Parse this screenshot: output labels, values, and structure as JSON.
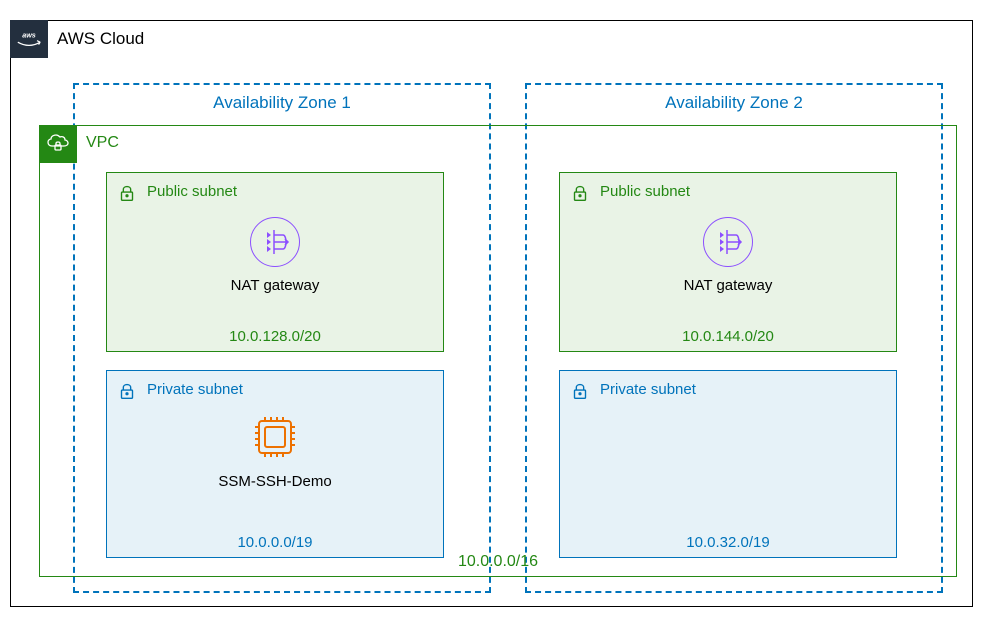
{
  "cloud": {
    "title": "AWS Cloud"
  },
  "vpc": {
    "title": "VPC",
    "cidr": "10.0.0.0/16"
  },
  "availability_zones": [
    {
      "title": "Availability Zone 1",
      "public_subnet": {
        "title": "Public subnet",
        "cidr": "10.0.128.0/20",
        "resource": {
          "type": "nat-gateway",
          "label": "NAT gateway"
        }
      },
      "private_subnet": {
        "title": "Private subnet",
        "cidr": "10.0.0.0/19",
        "resource": {
          "type": "ec2-instance",
          "label": "SSM-SSH-Demo"
        }
      }
    },
    {
      "title": "Availability Zone 2",
      "public_subnet": {
        "title": "Public subnet",
        "cidr": "10.0.144.0/20",
        "resource": {
          "type": "nat-gateway",
          "label": "NAT gateway"
        }
      },
      "private_subnet": {
        "title": "Private subnet",
        "cidr": "10.0.32.0/19",
        "resource": null
      }
    }
  ],
  "colors": {
    "aws_dark": "#232F3E",
    "green": "#248814",
    "blue": "#0073BB",
    "purple": "#8C4FFF",
    "orange": "#ED7100"
  }
}
